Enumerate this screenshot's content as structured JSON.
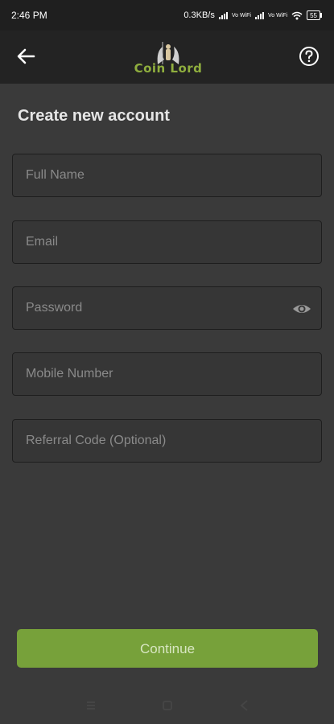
{
  "status_bar": {
    "time": "2:46 PM",
    "speed": "0.3KB/s",
    "volte1": "Vo WiFi",
    "volte2": "Vo WiFi",
    "battery": "55"
  },
  "app_bar": {
    "logo_text": "Coin Lord",
    "back_icon": "arrow-left-icon",
    "help_icon": "help-circle-icon"
  },
  "page": {
    "title": "Create new account"
  },
  "form": {
    "full_name_placeholder": "Full Name",
    "email_placeholder": "Email",
    "password_placeholder": "Password",
    "mobile_placeholder": "Mobile Number",
    "referral_placeholder": "Referral Code (Optional)",
    "continue_label": "Continue"
  },
  "colors": {
    "background": "#3a3a3a",
    "app_bar": "#232323",
    "accent": "#77a13a",
    "logo": "#8fae3e"
  }
}
